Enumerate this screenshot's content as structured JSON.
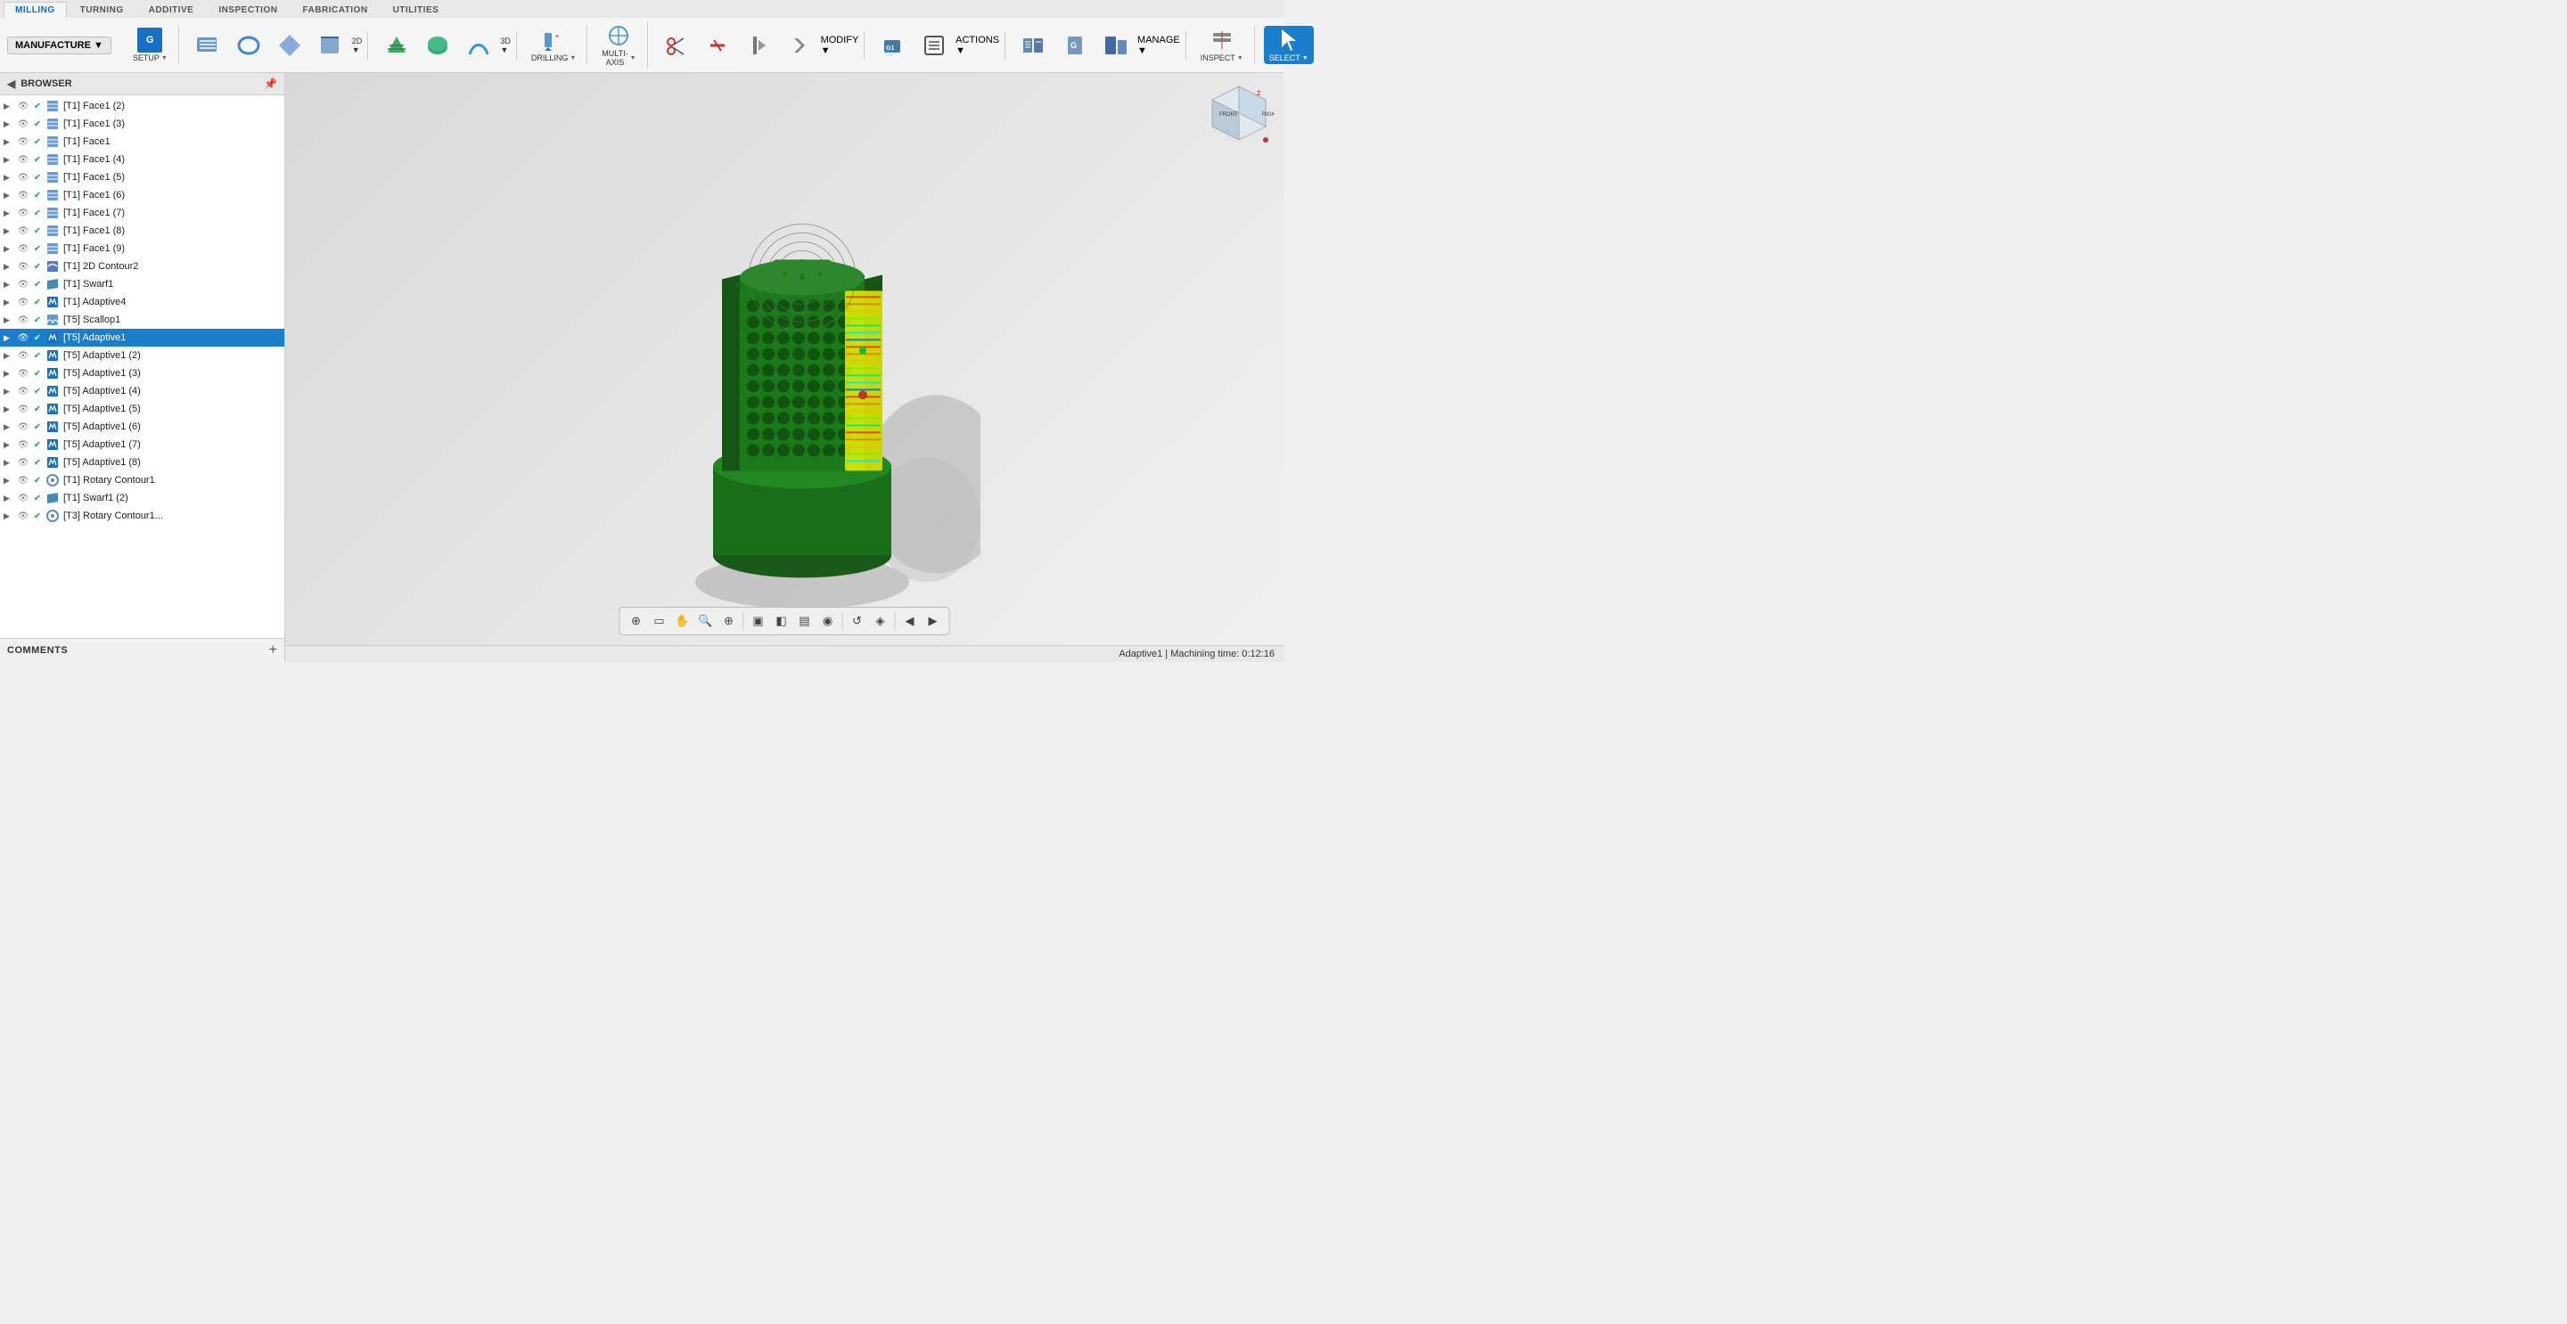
{
  "toolbar": {
    "manufacture_label": "MANUFACTURE",
    "tabs": [
      {
        "id": "milling",
        "label": "MILLING",
        "active": true
      },
      {
        "id": "turning",
        "label": "TURNING",
        "active": false
      },
      {
        "id": "additive",
        "label": "ADDITIVE",
        "active": false
      },
      {
        "id": "inspection",
        "label": "INSPECTION",
        "active": false
      },
      {
        "id": "fabrication",
        "label": "FABRICATION",
        "active": false
      },
      {
        "id": "utilities",
        "label": "UTILITIES",
        "active": false
      }
    ],
    "groups": [
      {
        "id": "setup",
        "items": [
          {
            "id": "setup",
            "label": "SETUP",
            "has_arrow": true
          }
        ]
      },
      {
        "id": "2d",
        "items": [
          {
            "id": "2d_face",
            "label": "",
            "sub": "2D ▼"
          },
          {
            "id": "2d_contour",
            "label": "",
            "sub": ""
          },
          {
            "id": "2d_pocket",
            "label": "",
            "sub": ""
          },
          {
            "id": "2d_bore",
            "label": "",
            "sub": ""
          }
        ],
        "group_label": "2D ▼"
      },
      {
        "id": "3d",
        "items": [
          {
            "id": "3d_adaptive",
            "label": "",
            "sub": ""
          },
          {
            "id": "3d_pocket",
            "label": "",
            "sub": ""
          },
          {
            "id": "3d_contour",
            "label": "",
            "sub": ""
          }
        ],
        "group_label": "3D ▼"
      },
      {
        "id": "drilling",
        "group_label": "DRILLING ▼"
      },
      {
        "id": "multiaxis",
        "group_label": "MULTI-AXIS ▼"
      },
      {
        "id": "modify",
        "group_label": "MODIFY ▼"
      },
      {
        "id": "actions",
        "group_label": "ACTIONS ▼"
      },
      {
        "id": "manage",
        "group_label": "MANAGE ▼"
      },
      {
        "id": "inspect",
        "group_label": "INSPECT ▼"
      },
      {
        "id": "select",
        "group_label": "SELECT ▼"
      }
    ]
  },
  "sidebar": {
    "header_label": "BROWSER",
    "items": [
      {
        "id": "t1_face2",
        "label": "[T1] Face1 (2)",
        "type": "face",
        "selected": false,
        "indent": 1
      },
      {
        "id": "t1_face3",
        "label": "[T1] Face1 (3)",
        "type": "face",
        "selected": false,
        "indent": 1
      },
      {
        "id": "t1_face1",
        "label": "[T1] Face1",
        "type": "face",
        "selected": false,
        "indent": 1
      },
      {
        "id": "t1_face4",
        "label": "[T1] Face1 (4)",
        "type": "face",
        "selected": false,
        "indent": 1
      },
      {
        "id": "t1_face5",
        "label": "[T1] Face1 (5)",
        "type": "face",
        "selected": false,
        "indent": 1
      },
      {
        "id": "t1_face6",
        "label": "[T1] Face1 (6)",
        "type": "face",
        "selected": false,
        "indent": 1
      },
      {
        "id": "t1_face7",
        "label": "[T1] Face1 (7)",
        "type": "face",
        "selected": false,
        "indent": 1
      },
      {
        "id": "t1_face8",
        "label": "[T1] Face1 (8)",
        "type": "face",
        "selected": false,
        "indent": 1
      },
      {
        "id": "t1_face9",
        "label": "[T1] Face1 (9)",
        "type": "face",
        "selected": false,
        "indent": 1
      },
      {
        "id": "t1_2dcontour2",
        "label": "[T1] 2D Contour2",
        "type": "contour",
        "selected": false,
        "indent": 1
      },
      {
        "id": "t1_swarf1",
        "label": "[T1] Swarf1",
        "type": "swarf",
        "selected": false,
        "indent": 1
      },
      {
        "id": "t1_adaptive4",
        "label": "[T1] Adaptive4",
        "type": "adaptive",
        "selected": false,
        "indent": 1
      },
      {
        "id": "t5_scallop1",
        "label": "[T5] Scallop1",
        "type": "scallop",
        "selected": false,
        "indent": 1
      },
      {
        "id": "t5_adaptive1",
        "label": "[T5] Adaptive1",
        "type": "adaptive",
        "selected": true,
        "indent": 1
      },
      {
        "id": "t5_adaptive1_2",
        "label": "[T5] Adaptive1 (2)",
        "type": "adaptive",
        "selected": false,
        "indent": 1
      },
      {
        "id": "t5_adaptive1_3",
        "label": "[T5] Adaptive1 (3)",
        "type": "adaptive",
        "selected": false,
        "indent": 1
      },
      {
        "id": "t5_adaptive1_4",
        "label": "[T5] Adaptive1 (4)",
        "type": "adaptive",
        "selected": false,
        "indent": 1
      },
      {
        "id": "t5_adaptive1_5",
        "label": "[T5] Adaptive1 (5)",
        "type": "adaptive",
        "selected": false,
        "indent": 1
      },
      {
        "id": "t5_adaptive1_6",
        "label": "[T5] Adaptive1 (6)",
        "type": "adaptive",
        "selected": false,
        "indent": 1
      },
      {
        "id": "t5_adaptive1_7",
        "label": "[T5] Adaptive1 (7)",
        "type": "adaptive",
        "selected": false,
        "indent": 1
      },
      {
        "id": "t5_adaptive1_8",
        "label": "[T5] Adaptive1 (8)",
        "type": "adaptive",
        "selected": false,
        "indent": 1
      },
      {
        "id": "t1_rotarycontour1",
        "label": "[T1] Rotary Contour1",
        "type": "rotary",
        "selected": false,
        "indent": 1
      },
      {
        "id": "t1_swarf1_2",
        "label": "[T1] Swarf1 (2)",
        "type": "swarf",
        "selected": false,
        "indent": 1
      },
      {
        "id": "t3_rotarycontour1",
        "label": "[T3] Rotary Contour1...",
        "type": "rotary",
        "selected": false,
        "indent": 1
      }
    ],
    "footer": {
      "comments_label": "COMMENTS",
      "add_btn": "+"
    }
  },
  "viewport": {
    "status_text": "Adaptive1 | Machining time: 0:12:16"
  },
  "nav_cube": {
    "front_label": "FRONT",
    "right_label": "RIGHT"
  },
  "bottom_toolbar": {
    "buttons": [
      {
        "id": "nav1",
        "icon": "⊕",
        "tooltip": "Navigate"
      },
      {
        "id": "nav2",
        "icon": "▭",
        "tooltip": "Fit"
      },
      {
        "id": "nav3",
        "icon": "✋",
        "tooltip": "Pan"
      },
      {
        "id": "nav4",
        "icon": "🔍",
        "tooltip": "Zoom"
      },
      {
        "id": "nav5",
        "icon": "⊕",
        "tooltip": "Zoom region"
      },
      {
        "id": "nav6",
        "icon": "▣",
        "tooltip": "View cube"
      },
      {
        "id": "nav7",
        "icon": "◧",
        "tooltip": "Grid"
      },
      {
        "id": "nav8",
        "icon": "▤",
        "tooltip": "Display"
      },
      {
        "id": "nav9",
        "icon": "○",
        "tooltip": "Orbit"
      },
      {
        "id": "nav10",
        "icon": "↺",
        "tooltip": "Undo"
      },
      {
        "id": "nav11",
        "icon": "◉",
        "tooltip": "Appearance"
      },
      {
        "id": "nav12",
        "icon": "◈",
        "tooltip": "Section"
      },
      {
        "id": "nav13",
        "icon": "◀",
        "tooltip": "Move left"
      },
      {
        "id": "nav14",
        "icon": "▶",
        "tooltip": "Move right"
      }
    ]
  },
  "colors": {
    "active_tab": "#0070cc",
    "selected_item": "#1a7ecc",
    "toolbar_bg": "#f5f5f5",
    "sidebar_bg": "#ffffff",
    "model_green": "#1a6e1a",
    "accent_yellow": "#ffff00"
  }
}
